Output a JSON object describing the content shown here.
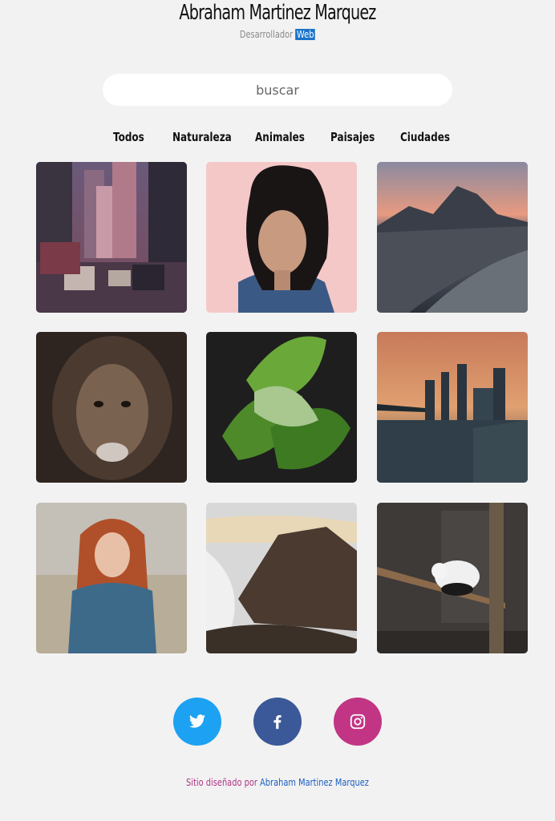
{
  "header": {
    "title": "Abraham Martinez Marquez",
    "subtitle_prefix": "Desarrollador",
    "subtitle_highlight": "Web"
  },
  "search": {
    "placeholder": "buscar"
  },
  "filters": [
    {
      "label": "Todos"
    },
    {
      "label": "Naturaleza"
    },
    {
      "label": "Animales"
    },
    {
      "label": "Paisajes"
    },
    {
      "label": "Ciudades"
    }
  ],
  "gallery": [
    {
      "subject": "city-street-traffic"
    },
    {
      "subject": "woman-portrait"
    },
    {
      "subject": "coastal-mountain-sunset"
    },
    {
      "subject": "lion-portrait"
    },
    {
      "subject": "green-leaves"
    },
    {
      "subject": "city-skyline-sunset"
    },
    {
      "subject": "red-haired-woman"
    },
    {
      "subject": "mountain-clouds"
    },
    {
      "subject": "panda-on-bamboo"
    }
  ],
  "social": [
    {
      "name": "twitter",
      "color": "#1da1f2"
    },
    {
      "name": "facebook",
      "color": "#3b5998"
    },
    {
      "name": "instagram",
      "color": "#c13584"
    }
  ],
  "footer": {
    "lead": "Sitio diseñado por",
    "author": "Abraham Martinez Marquez"
  },
  "colors": {
    "background": "#f2f2f2",
    "accent_blue": "#1a73c9",
    "footer_pink": "#b03585"
  }
}
